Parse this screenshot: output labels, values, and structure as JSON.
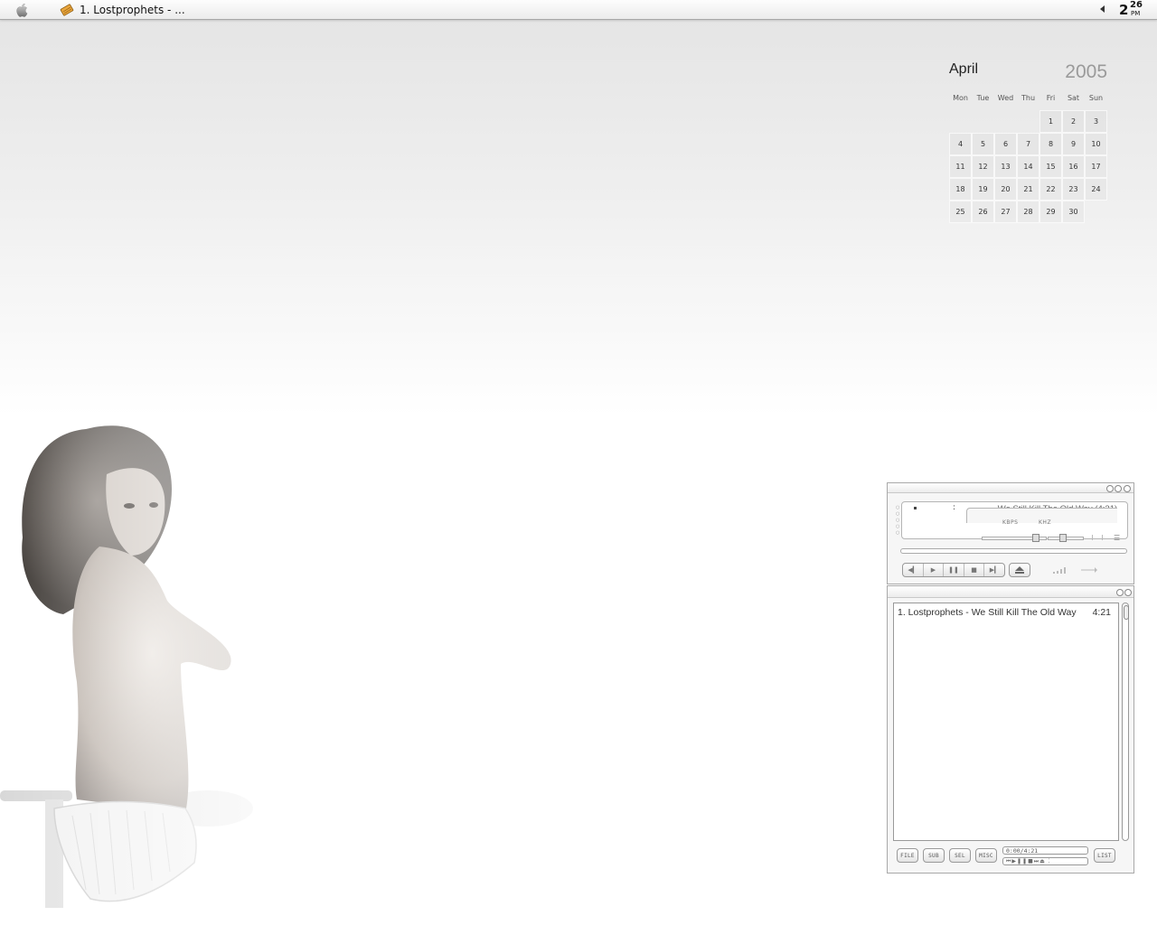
{
  "menubar": {
    "apple_icon": "apple-logo-icon",
    "task_title": "1. Lostprophets - ...",
    "task_icon": "winamp-pencil-icon",
    "clock": {
      "hour": "2",
      "minutes": "26",
      "ampm": "PM"
    }
  },
  "calendar": {
    "month": "April",
    "year": "2005",
    "weekdays": [
      "Mon",
      "Tue",
      "Wed",
      "Thu",
      "Fri",
      "Sat",
      "Sun"
    ],
    "leading_blanks": 4,
    "days": [
      "1",
      "2",
      "3",
      "4",
      "5",
      "6",
      "7",
      "8",
      "9",
      "10",
      "11",
      "12",
      "13",
      "14",
      "15",
      "16",
      "17",
      "18",
      "19",
      "20",
      "21",
      "22",
      "23",
      "24",
      "25",
      "26",
      "27",
      "28",
      "29",
      "30"
    ]
  },
  "player": {
    "track_display": "- We Still Kill The Old Way (4:21)",
    "time_colon": ":",
    "kbps_label": "KBPS",
    "khz_label": "KHZ",
    "transport": [
      "prev",
      "play",
      "pause",
      "stop",
      "next"
    ],
    "eject_icon": "eject-icon"
  },
  "playlist": {
    "items": [
      {
        "title": "1. Lostprophets - We Still Kill The Old Way",
        "duration": "4:21"
      }
    ],
    "buttons": {
      "file": "FILE",
      "sub": "SUB",
      "sel": "SEL",
      "misc": "MISC",
      "list": "LIST"
    },
    "time_display": "0:00/4:21"
  },
  "colors": {
    "accent": "#a9a9a9",
    "background": "#ffffff"
  }
}
